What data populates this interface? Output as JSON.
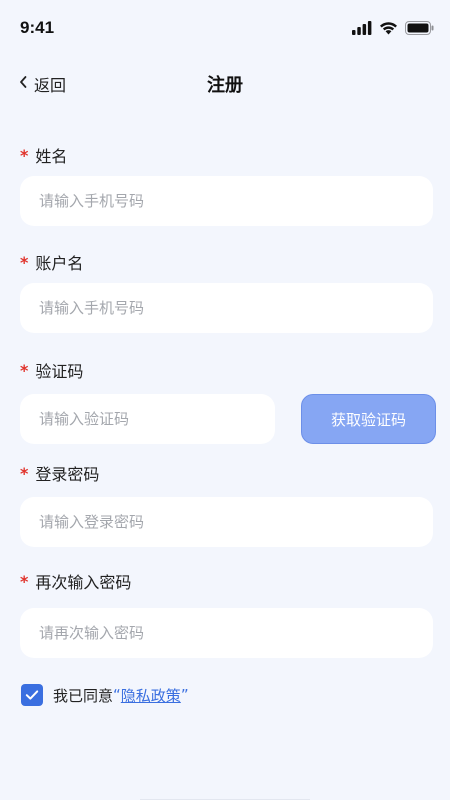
{
  "status_bar": {
    "time": "9:41",
    "icons": [
      "signal-icon",
      "wifi-icon",
      "battery-icon"
    ]
  },
  "nav": {
    "back_label": "返回",
    "title": "注册"
  },
  "form": {
    "required_mark": "*",
    "name": {
      "label": "姓名",
      "placeholder": "请输入手机号码"
    },
    "account": {
      "label": "账户名",
      "placeholder": "请输入手机号码"
    },
    "code": {
      "label": "验证码",
      "placeholder": "请输入验证码",
      "button_label": "获取验证码"
    },
    "password": {
      "label": "登录密码",
      "placeholder": "请输入登录密码"
    },
    "confirm_password": {
      "label": "再次输入密码",
      "placeholder": "请再次输入密码"
    }
  },
  "agreement": {
    "checked": true,
    "prefix": "我已同意",
    "open_quote": "“",
    "link_text": "隐私政策",
    "close_quote": "”"
  },
  "colors": {
    "accent": "#3a6fe0",
    "button_bg": "#86a6f3",
    "required": "#e0322b",
    "page_bg": "#f3f6fd"
  }
}
